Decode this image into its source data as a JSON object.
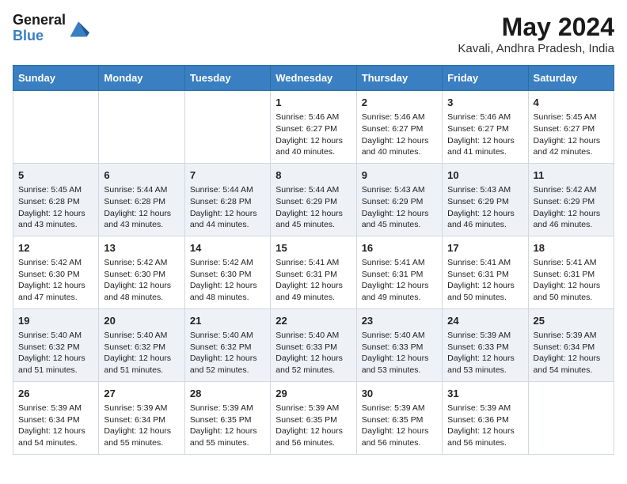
{
  "logo": {
    "line1": "General",
    "line2": "Blue"
  },
  "title": "May 2024",
  "subtitle": "Kavali, Andhra Pradesh, India",
  "days_of_week": [
    "Sunday",
    "Monday",
    "Tuesday",
    "Wednesday",
    "Thursday",
    "Friday",
    "Saturday"
  ],
  "weeks": [
    [
      {
        "day": "",
        "info": ""
      },
      {
        "day": "",
        "info": ""
      },
      {
        "day": "",
        "info": ""
      },
      {
        "day": "1",
        "info": "Sunrise: 5:46 AM\nSunset: 6:27 PM\nDaylight: 12 hours\nand 40 minutes."
      },
      {
        "day": "2",
        "info": "Sunrise: 5:46 AM\nSunset: 6:27 PM\nDaylight: 12 hours\nand 40 minutes."
      },
      {
        "day": "3",
        "info": "Sunrise: 5:46 AM\nSunset: 6:27 PM\nDaylight: 12 hours\nand 41 minutes."
      },
      {
        "day": "4",
        "info": "Sunrise: 5:45 AM\nSunset: 6:27 PM\nDaylight: 12 hours\nand 42 minutes."
      }
    ],
    [
      {
        "day": "5",
        "info": "Sunrise: 5:45 AM\nSunset: 6:28 PM\nDaylight: 12 hours\nand 43 minutes."
      },
      {
        "day": "6",
        "info": "Sunrise: 5:44 AM\nSunset: 6:28 PM\nDaylight: 12 hours\nand 43 minutes."
      },
      {
        "day": "7",
        "info": "Sunrise: 5:44 AM\nSunset: 6:28 PM\nDaylight: 12 hours\nand 44 minutes."
      },
      {
        "day": "8",
        "info": "Sunrise: 5:44 AM\nSunset: 6:29 PM\nDaylight: 12 hours\nand 45 minutes."
      },
      {
        "day": "9",
        "info": "Sunrise: 5:43 AM\nSunset: 6:29 PM\nDaylight: 12 hours\nand 45 minutes."
      },
      {
        "day": "10",
        "info": "Sunrise: 5:43 AM\nSunset: 6:29 PM\nDaylight: 12 hours\nand 46 minutes."
      },
      {
        "day": "11",
        "info": "Sunrise: 5:42 AM\nSunset: 6:29 PM\nDaylight: 12 hours\nand 46 minutes."
      }
    ],
    [
      {
        "day": "12",
        "info": "Sunrise: 5:42 AM\nSunset: 6:30 PM\nDaylight: 12 hours\nand 47 minutes."
      },
      {
        "day": "13",
        "info": "Sunrise: 5:42 AM\nSunset: 6:30 PM\nDaylight: 12 hours\nand 48 minutes."
      },
      {
        "day": "14",
        "info": "Sunrise: 5:42 AM\nSunset: 6:30 PM\nDaylight: 12 hours\nand 48 minutes."
      },
      {
        "day": "15",
        "info": "Sunrise: 5:41 AM\nSunset: 6:31 PM\nDaylight: 12 hours\nand 49 minutes."
      },
      {
        "day": "16",
        "info": "Sunrise: 5:41 AM\nSunset: 6:31 PM\nDaylight: 12 hours\nand 49 minutes."
      },
      {
        "day": "17",
        "info": "Sunrise: 5:41 AM\nSunset: 6:31 PM\nDaylight: 12 hours\nand 50 minutes."
      },
      {
        "day": "18",
        "info": "Sunrise: 5:41 AM\nSunset: 6:31 PM\nDaylight: 12 hours\nand 50 minutes."
      }
    ],
    [
      {
        "day": "19",
        "info": "Sunrise: 5:40 AM\nSunset: 6:32 PM\nDaylight: 12 hours\nand 51 minutes."
      },
      {
        "day": "20",
        "info": "Sunrise: 5:40 AM\nSunset: 6:32 PM\nDaylight: 12 hours\nand 51 minutes."
      },
      {
        "day": "21",
        "info": "Sunrise: 5:40 AM\nSunset: 6:32 PM\nDaylight: 12 hours\nand 52 minutes."
      },
      {
        "day": "22",
        "info": "Sunrise: 5:40 AM\nSunset: 6:33 PM\nDaylight: 12 hours\nand 52 minutes."
      },
      {
        "day": "23",
        "info": "Sunrise: 5:40 AM\nSunset: 6:33 PM\nDaylight: 12 hours\nand 53 minutes."
      },
      {
        "day": "24",
        "info": "Sunrise: 5:39 AM\nSunset: 6:33 PM\nDaylight: 12 hours\nand 53 minutes."
      },
      {
        "day": "25",
        "info": "Sunrise: 5:39 AM\nSunset: 6:34 PM\nDaylight: 12 hours\nand 54 minutes."
      }
    ],
    [
      {
        "day": "26",
        "info": "Sunrise: 5:39 AM\nSunset: 6:34 PM\nDaylight: 12 hours\nand 54 minutes."
      },
      {
        "day": "27",
        "info": "Sunrise: 5:39 AM\nSunset: 6:34 PM\nDaylight: 12 hours\nand 55 minutes."
      },
      {
        "day": "28",
        "info": "Sunrise: 5:39 AM\nSunset: 6:35 PM\nDaylight: 12 hours\nand 55 minutes."
      },
      {
        "day": "29",
        "info": "Sunrise: 5:39 AM\nSunset: 6:35 PM\nDaylight: 12 hours\nand 56 minutes."
      },
      {
        "day": "30",
        "info": "Sunrise: 5:39 AM\nSunset: 6:35 PM\nDaylight: 12 hours\nand 56 minutes."
      },
      {
        "day": "31",
        "info": "Sunrise: 5:39 AM\nSunset: 6:36 PM\nDaylight: 12 hours\nand 56 minutes."
      },
      {
        "day": "",
        "info": ""
      }
    ]
  ],
  "colors": {
    "header_bg": "#3a7fc1",
    "row_odd": "#ffffff",
    "row_even": "#eef2f7"
  }
}
